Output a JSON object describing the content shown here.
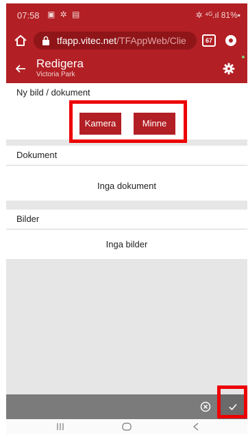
{
  "status_bar": {
    "time": "07:58",
    "left_icons": "▣ ✲ ▤",
    "right_text": "✲ ⁴ᴳ.ıl 81%▪"
  },
  "browser": {
    "host": "tfapp.vitec.net",
    "path": "/TFAppWeb/Clie",
    "tab_count": "67"
  },
  "header": {
    "title": "Redigera",
    "subtitle": "Victoria Park"
  },
  "new_doc": {
    "title": "Ny bild / dokument",
    "camera_label": "Kamera",
    "memory_label": "Minne"
  },
  "documents": {
    "title": "Dokument",
    "empty_text": "Inga dokument"
  },
  "images": {
    "title": "Bilder",
    "empty_text": "Inga bilder"
  },
  "colors": {
    "accent": "#b21f24",
    "highlight": "#ee0000",
    "footer": "#7b7b7b"
  },
  "icons": [
    "home-icon",
    "lock-icon",
    "tabs-icon",
    "menu-icon",
    "back-icon",
    "gear-icon",
    "cancel-icon",
    "check-icon",
    "recents-icon",
    "nav-home-icon",
    "nav-back-icon"
  ]
}
